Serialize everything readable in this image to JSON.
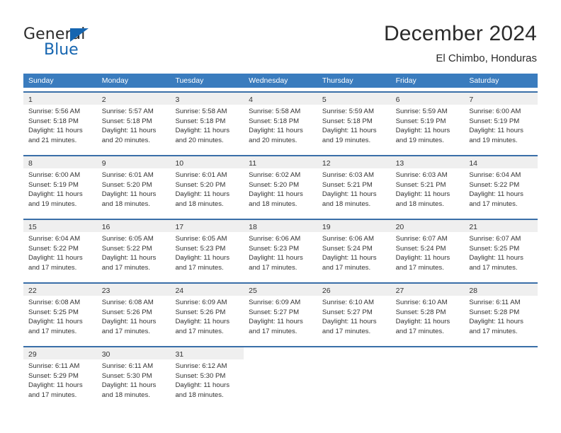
{
  "logo": {
    "word_top": "General",
    "word_bottom": "Blue",
    "triangle_icon": "triangle-icon",
    "brand_color": "#1565b0"
  },
  "header": {
    "title": "December 2024",
    "subtitle": "El Chimbo, Honduras"
  },
  "colors": {
    "header_row_bg": "#3a7cbe",
    "week_divider": "#3a6fa8",
    "day_band_bg": "#efefef",
    "text": "#333333"
  },
  "weekdays": [
    "Sunday",
    "Monday",
    "Tuesday",
    "Wednesday",
    "Thursday",
    "Friday",
    "Saturday"
  ],
  "weeks": [
    [
      {
        "day": "1",
        "sunrise": "Sunrise: 5:56 AM",
        "sunset": "Sunset: 5:18 PM",
        "daylight1": "Daylight: 11 hours",
        "daylight2": "and 21 minutes."
      },
      {
        "day": "2",
        "sunrise": "Sunrise: 5:57 AM",
        "sunset": "Sunset: 5:18 PM",
        "daylight1": "Daylight: 11 hours",
        "daylight2": "and 20 minutes."
      },
      {
        "day": "3",
        "sunrise": "Sunrise: 5:58 AM",
        "sunset": "Sunset: 5:18 PM",
        "daylight1": "Daylight: 11 hours",
        "daylight2": "and 20 minutes."
      },
      {
        "day": "4",
        "sunrise": "Sunrise: 5:58 AM",
        "sunset": "Sunset: 5:18 PM",
        "daylight1": "Daylight: 11 hours",
        "daylight2": "and 20 minutes."
      },
      {
        "day": "5",
        "sunrise": "Sunrise: 5:59 AM",
        "sunset": "Sunset: 5:18 PM",
        "daylight1": "Daylight: 11 hours",
        "daylight2": "and 19 minutes."
      },
      {
        "day": "6",
        "sunrise": "Sunrise: 5:59 AM",
        "sunset": "Sunset: 5:19 PM",
        "daylight1": "Daylight: 11 hours",
        "daylight2": "and 19 minutes."
      },
      {
        "day": "7",
        "sunrise": "Sunrise: 6:00 AM",
        "sunset": "Sunset: 5:19 PM",
        "daylight1": "Daylight: 11 hours",
        "daylight2": "and 19 minutes."
      }
    ],
    [
      {
        "day": "8",
        "sunrise": "Sunrise: 6:00 AM",
        "sunset": "Sunset: 5:19 PM",
        "daylight1": "Daylight: 11 hours",
        "daylight2": "and 19 minutes."
      },
      {
        "day": "9",
        "sunrise": "Sunrise: 6:01 AM",
        "sunset": "Sunset: 5:20 PM",
        "daylight1": "Daylight: 11 hours",
        "daylight2": "and 18 minutes."
      },
      {
        "day": "10",
        "sunrise": "Sunrise: 6:01 AM",
        "sunset": "Sunset: 5:20 PM",
        "daylight1": "Daylight: 11 hours",
        "daylight2": "and 18 minutes."
      },
      {
        "day": "11",
        "sunrise": "Sunrise: 6:02 AM",
        "sunset": "Sunset: 5:20 PM",
        "daylight1": "Daylight: 11 hours",
        "daylight2": "and 18 minutes."
      },
      {
        "day": "12",
        "sunrise": "Sunrise: 6:03 AM",
        "sunset": "Sunset: 5:21 PM",
        "daylight1": "Daylight: 11 hours",
        "daylight2": "and 18 minutes."
      },
      {
        "day": "13",
        "sunrise": "Sunrise: 6:03 AM",
        "sunset": "Sunset: 5:21 PM",
        "daylight1": "Daylight: 11 hours",
        "daylight2": "and 18 minutes."
      },
      {
        "day": "14",
        "sunrise": "Sunrise: 6:04 AM",
        "sunset": "Sunset: 5:22 PM",
        "daylight1": "Daylight: 11 hours",
        "daylight2": "and 17 minutes."
      }
    ],
    [
      {
        "day": "15",
        "sunrise": "Sunrise: 6:04 AM",
        "sunset": "Sunset: 5:22 PM",
        "daylight1": "Daylight: 11 hours",
        "daylight2": "and 17 minutes."
      },
      {
        "day": "16",
        "sunrise": "Sunrise: 6:05 AM",
        "sunset": "Sunset: 5:22 PM",
        "daylight1": "Daylight: 11 hours",
        "daylight2": "and 17 minutes."
      },
      {
        "day": "17",
        "sunrise": "Sunrise: 6:05 AM",
        "sunset": "Sunset: 5:23 PM",
        "daylight1": "Daylight: 11 hours",
        "daylight2": "and 17 minutes."
      },
      {
        "day": "18",
        "sunrise": "Sunrise: 6:06 AM",
        "sunset": "Sunset: 5:23 PM",
        "daylight1": "Daylight: 11 hours",
        "daylight2": "and 17 minutes."
      },
      {
        "day": "19",
        "sunrise": "Sunrise: 6:06 AM",
        "sunset": "Sunset: 5:24 PM",
        "daylight1": "Daylight: 11 hours",
        "daylight2": "and 17 minutes."
      },
      {
        "day": "20",
        "sunrise": "Sunrise: 6:07 AM",
        "sunset": "Sunset: 5:24 PM",
        "daylight1": "Daylight: 11 hours",
        "daylight2": "and 17 minutes."
      },
      {
        "day": "21",
        "sunrise": "Sunrise: 6:07 AM",
        "sunset": "Sunset: 5:25 PM",
        "daylight1": "Daylight: 11 hours",
        "daylight2": "and 17 minutes."
      }
    ],
    [
      {
        "day": "22",
        "sunrise": "Sunrise: 6:08 AM",
        "sunset": "Sunset: 5:25 PM",
        "daylight1": "Daylight: 11 hours",
        "daylight2": "and 17 minutes."
      },
      {
        "day": "23",
        "sunrise": "Sunrise: 6:08 AM",
        "sunset": "Sunset: 5:26 PM",
        "daylight1": "Daylight: 11 hours",
        "daylight2": "and 17 minutes."
      },
      {
        "day": "24",
        "sunrise": "Sunrise: 6:09 AM",
        "sunset": "Sunset: 5:26 PM",
        "daylight1": "Daylight: 11 hours",
        "daylight2": "and 17 minutes."
      },
      {
        "day": "25",
        "sunrise": "Sunrise: 6:09 AM",
        "sunset": "Sunset: 5:27 PM",
        "daylight1": "Daylight: 11 hours",
        "daylight2": "and 17 minutes."
      },
      {
        "day": "26",
        "sunrise": "Sunrise: 6:10 AM",
        "sunset": "Sunset: 5:27 PM",
        "daylight1": "Daylight: 11 hours",
        "daylight2": "and 17 minutes."
      },
      {
        "day": "27",
        "sunrise": "Sunrise: 6:10 AM",
        "sunset": "Sunset: 5:28 PM",
        "daylight1": "Daylight: 11 hours",
        "daylight2": "and 17 minutes."
      },
      {
        "day": "28",
        "sunrise": "Sunrise: 6:11 AM",
        "sunset": "Sunset: 5:28 PM",
        "daylight1": "Daylight: 11 hours",
        "daylight2": "and 17 minutes."
      }
    ],
    [
      {
        "day": "29",
        "sunrise": "Sunrise: 6:11 AM",
        "sunset": "Sunset: 5:29 PM",
        "daylight1": "Daylight: 11 hours",
        "daylight2": "and 17 minutes."
      },
      {
        "day": "30",
        "sunrise": "Sunrise: 6:11 AM",
        "sunset": "Sunset: 5:30 PM",
        "daylight1": "Daylight: 11 hours",
        "daylight2": "and 18 minutes."
      },
      {
        "day": "31",
        "sunrise": "Sunrise: 6:12 AM",
        "sunset": "Sunset: 5:30 PM",
        "daylight1": "Daylight: 11 hours",
        "daylight2": "and 18 minutes."
      },
      {
        "day": "",
        "sunrise": "",
        "sunset": "",
        "daylight1": "",
        "daylight2": ""
      },
      {
        "day": "",
        "sunrise": "",
        "sunset": "",
        "daylight1": "",
        "daylight2": ""
      },
      {
        "day": "",
        "sunrise": "",
        "sunset": "",
        "daylight1": "",
        "daylight2": ""
      },
      {
        "day": "",
        "sunrise": "",
        "sunset": "",
        "daylight1": "",
        "daylight2": ""
      }
    ]
  ]
}
